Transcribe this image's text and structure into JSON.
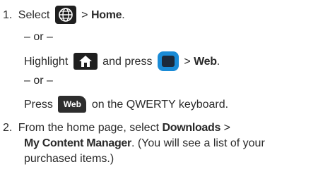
{
  "step1": {
    "number": "1.",
    "text_select": "Select",
    "gt": ">",
    "home_label": "Home",
    "period": ".",
    "or1": "– or –",
    "highlight": "Highlight",
    "and_press": "and press",
    "web_label": "Web",
    "or2": "– or –",
    "press": "Press",
    "web_key_label": "Web",
    "qwerty_text": "on the QWERTY keyboard."
  },
  "step2": {
    "number": "2.",
    "line1_text": "From the home page, select",
    "downloads_label": "Downloads",
    "gt": ">",
    "my_content_label": "My Content Manager",
    "line2_rest": ". (You will see a list of your",
    "line3_text": "purchased items.)"
  },
  "icons": {
    "globe": "globe-icon",
    "home": "home-icon",
    "menu_key": "menu-key-icon",
    "web_key": "web-key-icon"
  }
}
